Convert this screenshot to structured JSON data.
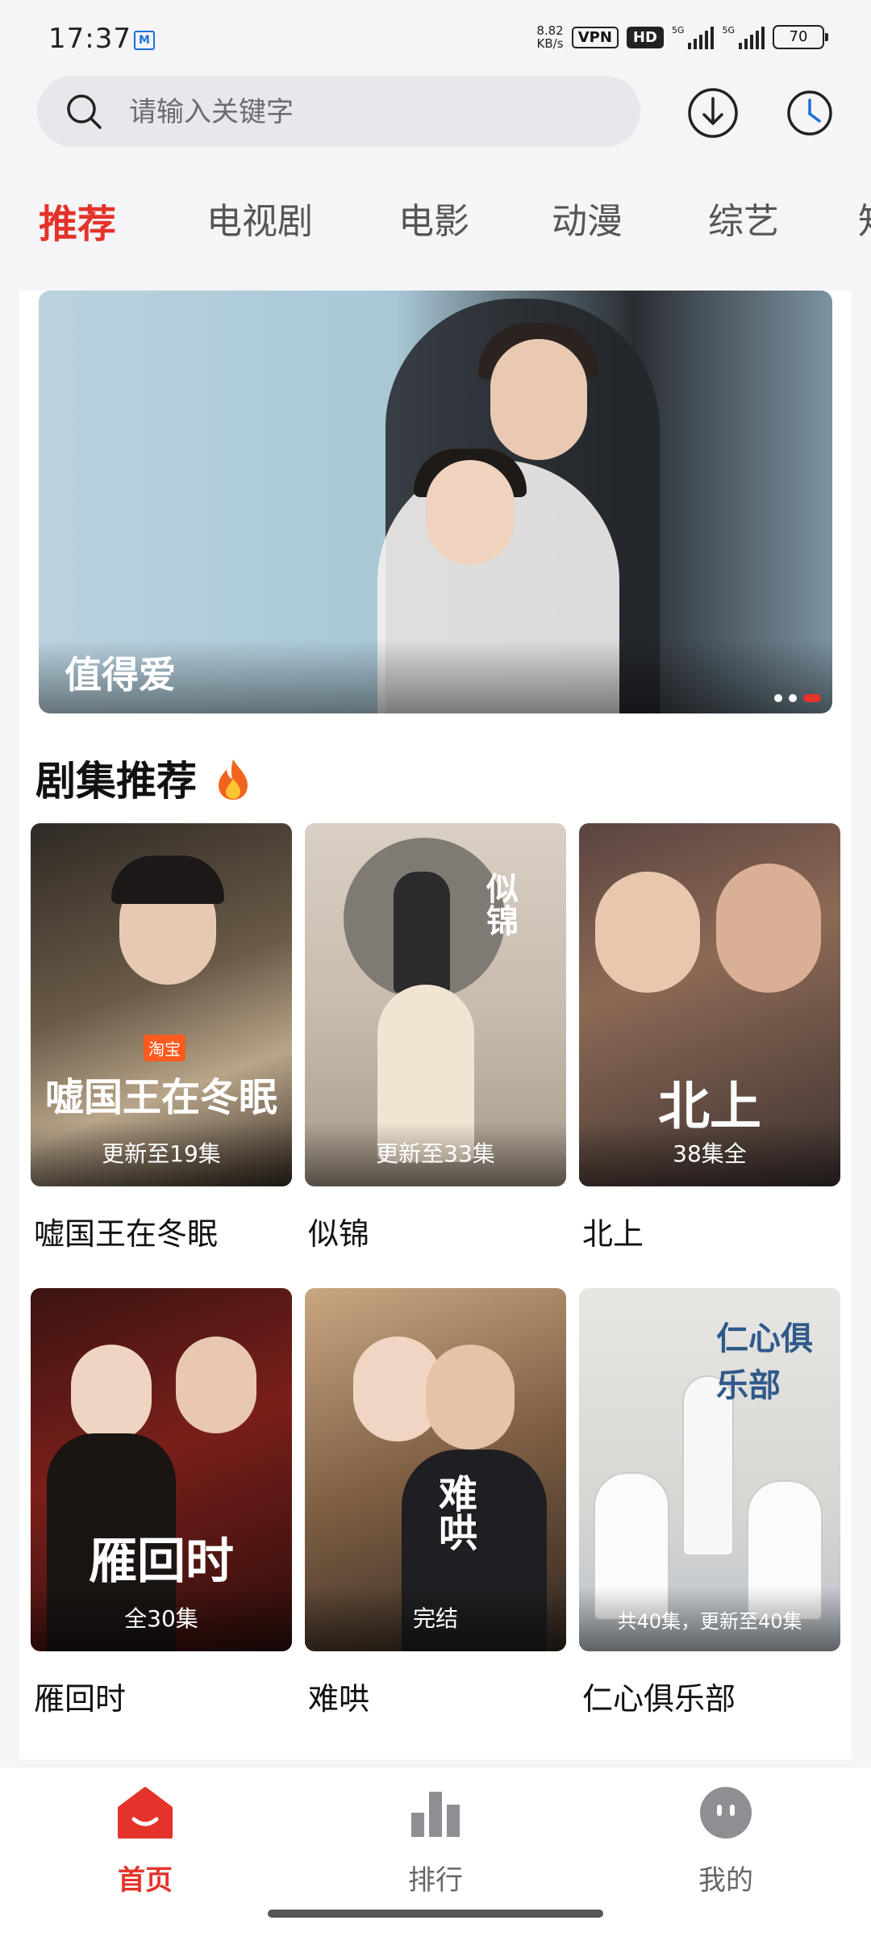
{
  "status_bar": {
    "time": "17:37",
    "net_speed_value": "8.82",
    "net_speed_unit": "KB/s",
    "vpn": "VPN",
    "hd": "HD",
    "signal1": "5G",
    "signal2": "5G",
    "battery": "70"
  },
  "search": {
    "placeholder": "请输入关键字"
  },
  "tabs": [
    "推荐",
    "电视剧",
    "电影",
    "动漫",
    "综艺",
    "知"
  ],
  "banner": {
    "title": "值得爱",
    "dots": 3,
    "active_dot": 3
  },
  "section": {
    "title": "剧集推荐"
  },
  "shows": [
    {
      "name": "嘘国王在冬眠",
      "badge": "更新至19集",
      "poster_text": "嘘国王在冬眠",
      "tag": "淘宝"
    },
    {
      "name": "似锦",
      "badge": "更新至33集",
      "poster_text": "似锦"
    },
    {
      "name": "北上",
      "badge": "38集全",
      "poster_text": "北上"
    },
    {
      "name": "雁回时",
      "badge": "全30集",
      "poster_text": "雁回时"
    },
    {
      "name": "难哄",
      "badge": "完结",
      "poster_text": "难哄"
    },
    {
      "name": "仁心俱乐部",
      "badge": "共40集，更新至40集",
      "poster_text": "仁心俱乐部"
    }
  ],
  "bottom_nav": [
    {
      "label": "首页",
      "icon": "home-icon",
      "active": true
    },
    {
      "label": "排行",
      "icon": "bar-chart-icon",
      "active": false
    },
    {
      "label": "我的",
      "icon": "profile-face-icon",
      "active": false
    }
  ],
  "colors": {
    "accent": "#e4332a",
    "background": "#f5f4f7"
  }
}
